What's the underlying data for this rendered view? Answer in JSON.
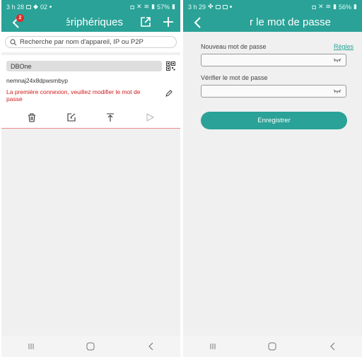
{
  "left": {
    "status": {
      "time": "3 h 28",
      "extra": "02",
      "battery": "57%"
    },
    "title": "périphériques",
    "badge": "2",
    "search": {
      "placeholder": "Recherche par nom d'appareil, IP ou P2P"
    },
    "device": {
      "name": "DBOne",
      "id": "nemnaj24x8dpwsmbyp",
      "warning": "La première connexion, veuillez modifier le mot de passe"
    },
    "actions": [
      "trash-icon",
      "edit-icon",
      "pin-icon",
      "play-icon"
    ]
  },
  "right": {
    "status": {
      "time": "3 h 29",
      "battery": "56%"
    },
    "title": "r le mot de passe",
    "fields": {
      "new_label": "Nouveau mot de passe",
      "rules_link": "Règles",
      "verify_label": "Vérifier le mot de passe"
    },
    "button": "Enregistrer"
  },
  "colors": {
    "accent": "#2aa297",
    "warning": "#d01c1c",
    "badge": "#e02b2b"
  },
  "nav": [
    "recents-icon",
    "home-icon",
    "back-icon"
  ]
}
